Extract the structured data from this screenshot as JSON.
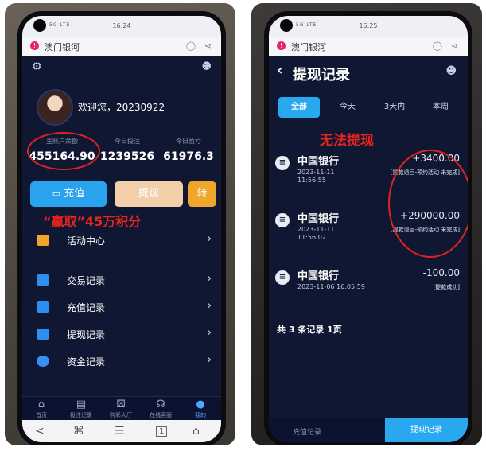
{
  "left": {
    "status": {
      "time": "16:24",
      "signal": "5G LTE"
    },
    "browser": {
      "site_title": "澳门银河",
      "icon_more": "more-icon",
      "icon_share": "share-icon"
    },
    "header": {
      "settings_icon": "gear-icon",
      "service_icon": "service-icon"
    },
    "user": {
      "welcome": "欢迎您，20230922"
    },
    "stats": [
      {
        "label": "主账户余额",
        "value": "455164.90"
      },
      {
        "label": "今日投注",
        "value": "1239526"
      },
      {
        "label": "今日盈亏",
        "value": "61976.3"
      }
    ],
    "buttons": {
      "deposit": "充值",
      "withdraw": "提现",
      "transfer": "转"
    },
    "annotation": "“赢取”45万积分",
    "menu": [
      {
        "label": "活动中心",
        "icon": "gift-icon"
      },
      {
        "label": "交易记录",
        "icon": "calendar-icon"
      },
      {
        "label": "充值记录",
        "icon": "calendar-icon"
      },
      {
        "label": "提现记录",
        "icon": "calendar-icon"
      },
      {
        "label": "资金记录",
        "icon": "wallet-icon"
      }
    ],
    "tabs": [
      {
        "label": "首页",
        "icon": "home-icon"
      },
      {
        "label": "投注记录",
        "icon": "list-icon"
      },
      {
        "label": "购彩大厅",
        "icon": "dice-icon"
      },
      {
        "label": "在线客服",
        "icon": "headset-icon"
      },
      {
        "label": "我的",
        "icon": "user-icon"
      }
    ],
    "nav": {
      "back": "<",
      "home": "⌘",
      "menu": "☰",
      "page": "1",
      "house": "⌂"
    }
  },
  "right": {
    "status": {
      "time": "16:25",
      "signal": "5G LTE"
    },
    "browser": {
      "site_title": "澳门银河",
      "icon_more": "more-icon",
      "icon_share": "share-icon"
    },
    "page_title": "提现记录",
    "filter_tabs": [
      "全部",
      "今天",
      "3天内",
      "本周"
    ],
    "annotation": "无法提现",
    "records": [
      {
        "bank": "中国银行",
        "date": "2023-11-11",
        "time": "11:56:55",
        "amount": "+3400.00",
        "status": "[提款退回-预约活动 未完成]"
      },
      {
        "bank": "中国银行",
        "date": "2023-11-11",
        "time": "11:56:02",
        "amount": "+290000.00",
        "status": "[提款退回-预约活动 未完成]"
      },
      {
        "bank": "中国银行",
        "date": "2023-11-06 16:05:59",
        "time": "",
        "amount": "-100.00",
        "status": "[提款成功]"
      }
    ],
    "total": "共 3 条记录 1页",
    "footer": {
      "left": "充值记录",
      "right": "提现记录"
    }
  },
  "colors": {
    "screen_bg": "#0f1732",
    "accent_blue": "#27a8ef",
    "annotation_red": "#e0231f",
    "withdraw_btn": "#f2cfa9",
    "transfer_btn": "#f0a62a"
  }
}
